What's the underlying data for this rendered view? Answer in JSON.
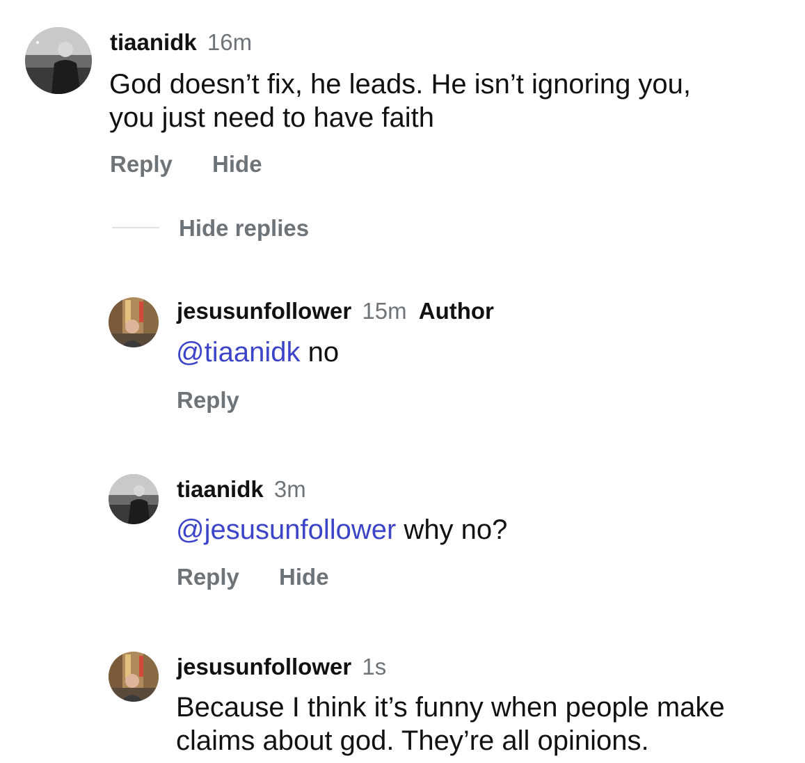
{
  "comments": [
    {
      "username": "tiaanidk",
      "time": "16m",
      "text": "God doesn’t fix, he leads. He isn’t ignoring you,",
      "text_line2": "you just need to have faith",
      "actions": {
        "reply": "Reply",
        "hide": "Hide"
      },
      "avatar_icon": "profile-photo-person"
    }
  ],
  "hide_replies_label": "Hide replies",
  "replies": [
    {
      "username": "jesusunfollower",
      "time": "15m",
      "badge": "Author",
      "mention": "@tiaanidk",
      "text": " no",
      "actions": {
        "reply": "Reply"
      },
      "avatar_icon": "profile-photo-street"
    },
    {
      "username": "tiaanidk",
      "time": "3m",
      "mention": "@jesusunfollower",
      "text": " why no?",
      "actions": {
        "reply": "Reply",
        "hide": "Hide"
      },
      "avatar_icon": "profile-photo-person"
    },
    {
      "username": "jesusunfollower",
      "time": "1s",
      "text": "Because I think it’s funny when people make",
      "text_line2": "claims about god. They’re all opinions.",
      "avatar_icon": "profile-photo-street"
    }
  ],
  "colors": {
    "text": "#111111",
    "secondary": "#6e7378",
    "mention": "#3c44c8",
    "divider": "#dfe1e4"
  }
}
